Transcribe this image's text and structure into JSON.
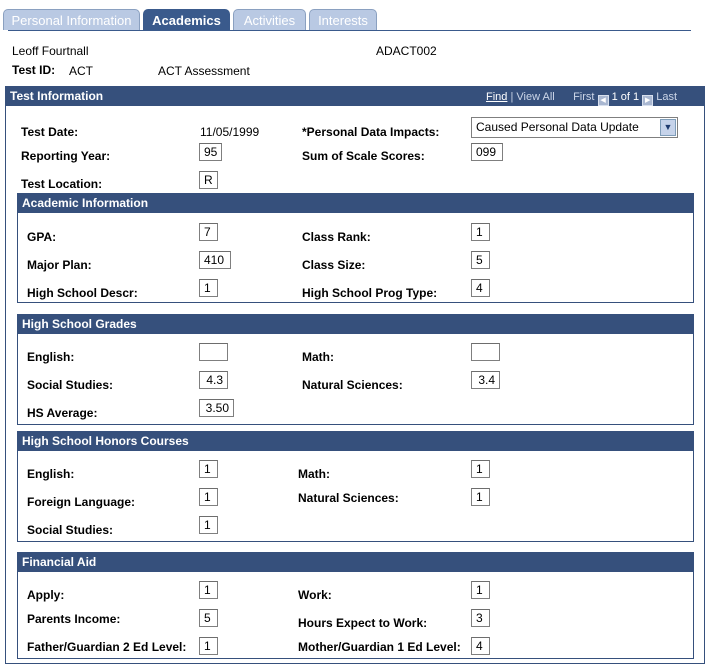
{
  "tabs": [
    {
      "label": "Personal Information",
      "active": false
    },
    {
      "label": "Academics",
      "active": true
    },
    {
      "label": "Activities",
      "active": false
    },
    {
      "label": "Interests",
      "active": false
    }
  ],
  "student": {
    "name": "Leoff Fourtnall",
    "code": "ADACT002",
    "test_id_label": "Test ID:",
    "test_id": "ACT",
    "test_desc": "ACT Assessment"
  },
  "test_info": {
    "title": "Test Information",
    "nav": {
      "find": "Find",
      "sep": "|",
      "view_all": "View All",
      "first": "First",
      "count": "1 of 1",
      "last": "Last"
    },
    "test_date_label": "Test Date:",
    "test_date": "11/05/1999",
    "impacts_label": "*Personal Data Impacts:",
    "impacts_value": "Caused Personal Data Update",
    "reporting_year_label": "Reporting Year:",
    "reporting_year": "95",
    "sum_scores_label": "Sum of Scale Scores:",
    "sum_scores": "099",
    "test_location_label": "Test Location:",
    "test_location": "R"
  },
  "academic": {
    "title": "Academic Information",
    "gpa_label": "GPA:",
    "gpa": "7",
    "class_rank_label": "Class Rank:",
    "class_rank": "1",
    "major_plan_label": "Major Plan:",
    "major_plan": "410",
    "class_size_label": "Class Size:",
    "class_size": "5",
    "hs_descr_label": "High School Descr:",
    "hs_descr": "1",
    "hs_prog_label": "High School Prog Type:",
    "hs_prog": "4"
  },
  "grades": {
    "title": "High School Grades",
    "english_label": "English:",
    "english": "",
    "math_label": "Math:",
    "math": "",
    "social_label": "Social Studies:",
    "social": "4.3",
    "natsci_label": "Natural Sciences:",
    "natsci": "3.4",
    "avg_label": "HS Average:",
    "avg": "3.50"
  },
  "honors": {
    "title": "High School Honors Courses",
    "english_label": "English:",
    "english": "1",
    "math_label": "Math:",
    "math": "1",
    "foreign_label": "Foreign Language:",
    "foreign": "1",
    "natsci_label": "Natural Sciences:",
    "natsci": "1",
    "social_label": "Social Studies:",
    "social": "1"
  },
  "financial": {
    "title": "Financial Aid",
    "apply_label": "Apply:",
    "apply": "1",
    "work_label": "Work:",
    "work": "1",
    "parents_income_label": "Parents Income:",
    "parents_income": "5",
    "hours_label": "Hours Expect to Work:",
    "hours": "3",
    "father_label": "Father/Guardian 2 Ed Level:",
    "father": "1",
    "mother_label": "Mother/Guardian 1 Ed Level:",
    "mother": "4"
  }
}
